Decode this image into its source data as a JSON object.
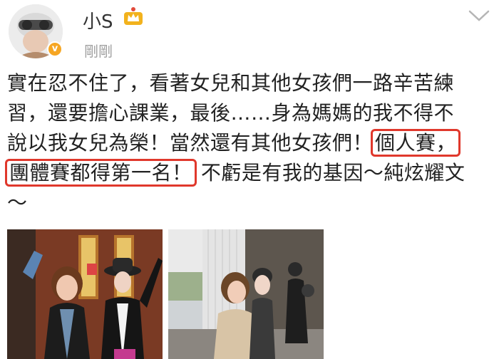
{
  "post": {
    "author": "小S",
    "timestamp": "剛剛",
    "text": {
      "line1": "實在忍不住了，看著女兒和其他女孩們一路辛苦練",
      "line2": "習，還要擔心課業，最後……身為媽媽的我不得不",
      "line3_plain": "說以我女兒為榮！當然還有其他女孩們！",
      "line3_highlight": "個人賽，",
      "line4_highlight": "團體賽都得第一名！",
      "line4_plain": " 不虧是有我的基因～純炫耀文",
      "line5": "～"
    }
  },
  "icons": {
    "verified": "verified-badge-icon",
    "member_crown": "crown-icon",
    "menu": "chevron-down-icon"
  },
  "colors": {
    "highlight_border": "#e0382c",
    "verified_badge": "#f6a623",
    "timestamp": "#a0a0a0"
  }
}
